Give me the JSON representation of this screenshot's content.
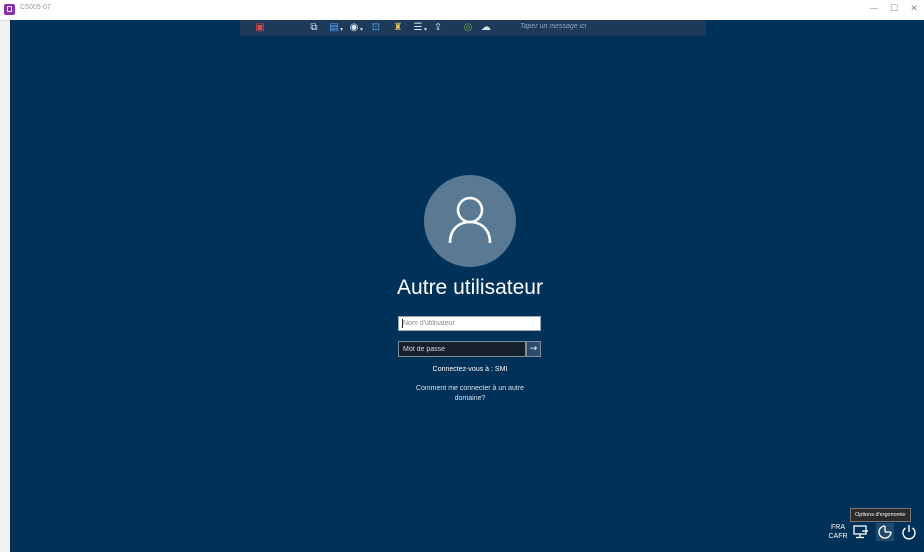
{
  "window": {
    "title": "C5005-07",
    "minimize": "—",
    "maximize": "☐",
    "close": "✕"
  },
  "toolbar": {
    "icons": [
      "disconnect-icon",
      "monitor-icon",
      "display-icon",
      "view-icon",
      "fullscreen-icon",
      "users-icon",
      "settings-icon",
      "file-transfer-icon",
      "record-icon",
      "chat-icon"
    ],
    "message_placeholder": "Taper un message ici"
  },
  "login": {
    "username_title": "Autre utilisateur",
    "username_placeholder": "Nom d'utilisateur",
    "password_placeholder": "Mot de passe",
    "submit_arrow": "→",
    "connect_to": "Connectez-vous à : SMI",
    "other_domain_line1": "Comment me connecter à un autre",
    "other_domain_line2": "domaine?"
  },
  "taskbar": {
    "lang_line1": "FRA",
    "lang_line2": "CAFR",
    "tooltip": "Options d'ergonomie"
  },
  "colors": {
    "background": "#003158",
    "avatar": "#5a7a93",
    "toolbar": "#1d3a5a"
  }
}
